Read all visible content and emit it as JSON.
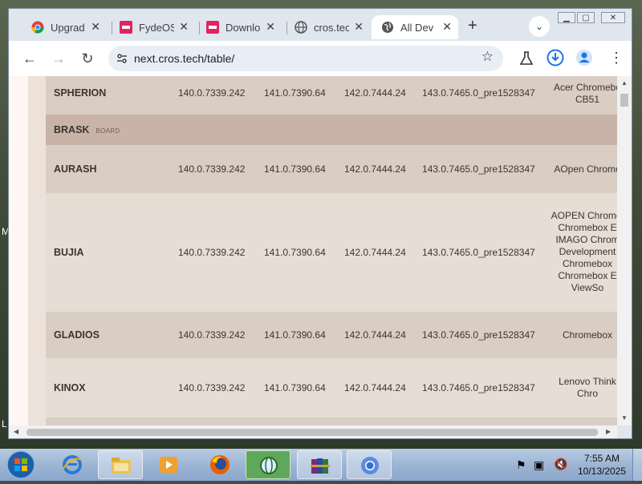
{
  "desktop": {
    "text_left_m": "M",
    "text_left_l": "L"
  },
  "browser": {
    "tabs": [
      {
        "title": "Upgrad",
        "icon": "chrome-icon"
      },
      {
        "title": "FydeOS",
        "icon": "fydeos-icon"
      },
      {
        "title": "Downlo",
        "icon": "fydeos-icon"
      },
      {
        "title": "cros.tec",
        "icon": "globe-icon"
      },
      {
        "title": "All Dev",
        "icon": "globe-icon",
        "active": true
      }
    ],
    "new_tab": "+",
    "url": "next.cros.tech/table/"
  },
  "table": {
    "rows": [
      {
        "name": "SPHERION",
        "v1": "140.0.7339.242",
        "v2": "141.0.7390.64",
        "v3": "142.0.7444.24",
        "v4": "143.0.7465.0_pre1528347",
        "desc": [
          "Acer Chromebo",
          "CB51"
        ]
      },
      {
        "name": "BRASK",
        "tag": "BOARD"
      },
      {
        "name": "AURASH",
        "v1": "140.0.7339.242",
        "v2": "141.0.7390.64",
        "v3": "142.0.7444.24",
        "v4": "143.0.7465.0_pre1528347",
        "desc": [
          "AOpen Chrome"
        ]
      },
      {
        "name": "BUJIA",
        "v1": "140.0.7339.242",
        "v2": "141.0.7390.64",
        "v3": "142.0.7444.24",
        "v4": "143.0.7465.0_pre1528347",
        "desc": [
          "AOPEN Chromel",
          "Chromebox E",
          "IMAGO Chrom",
          "Development",
          "Chromebox",
          "Chromebox E",
          "ViewSo"
        ]
      },
      {
        "name": "GLADIOS",
        "v1": "140.0.7339.242",
        "v2": "141.0.7390.64",
        "v3": "142.0.7444.24",
        "v4": "143.0.7465.0_pre1528347",
        "desc": [
          "Chromebox"
        ]
      },
      {
        "name": "KINOX",
        "v1": "140.0.7339.242",
        "v2": "141.0.7390.64",
        "v3": "142.0.7444.24",
        "v4": "143.0.7465.0_pre1528347",
        "desc": [
          "Lenovo Think",
          "Chro"
        ]
      }
    ]
  },
  "taskbar": {
    "time": "7:55 AM",
    "date": "10/13/2025"
  },
  "colors": {
    "row_light": "#e6ddd4",
    "row_dark": "#d9cdc4",
    "row_header": "#c9b3a9"
  }
}
